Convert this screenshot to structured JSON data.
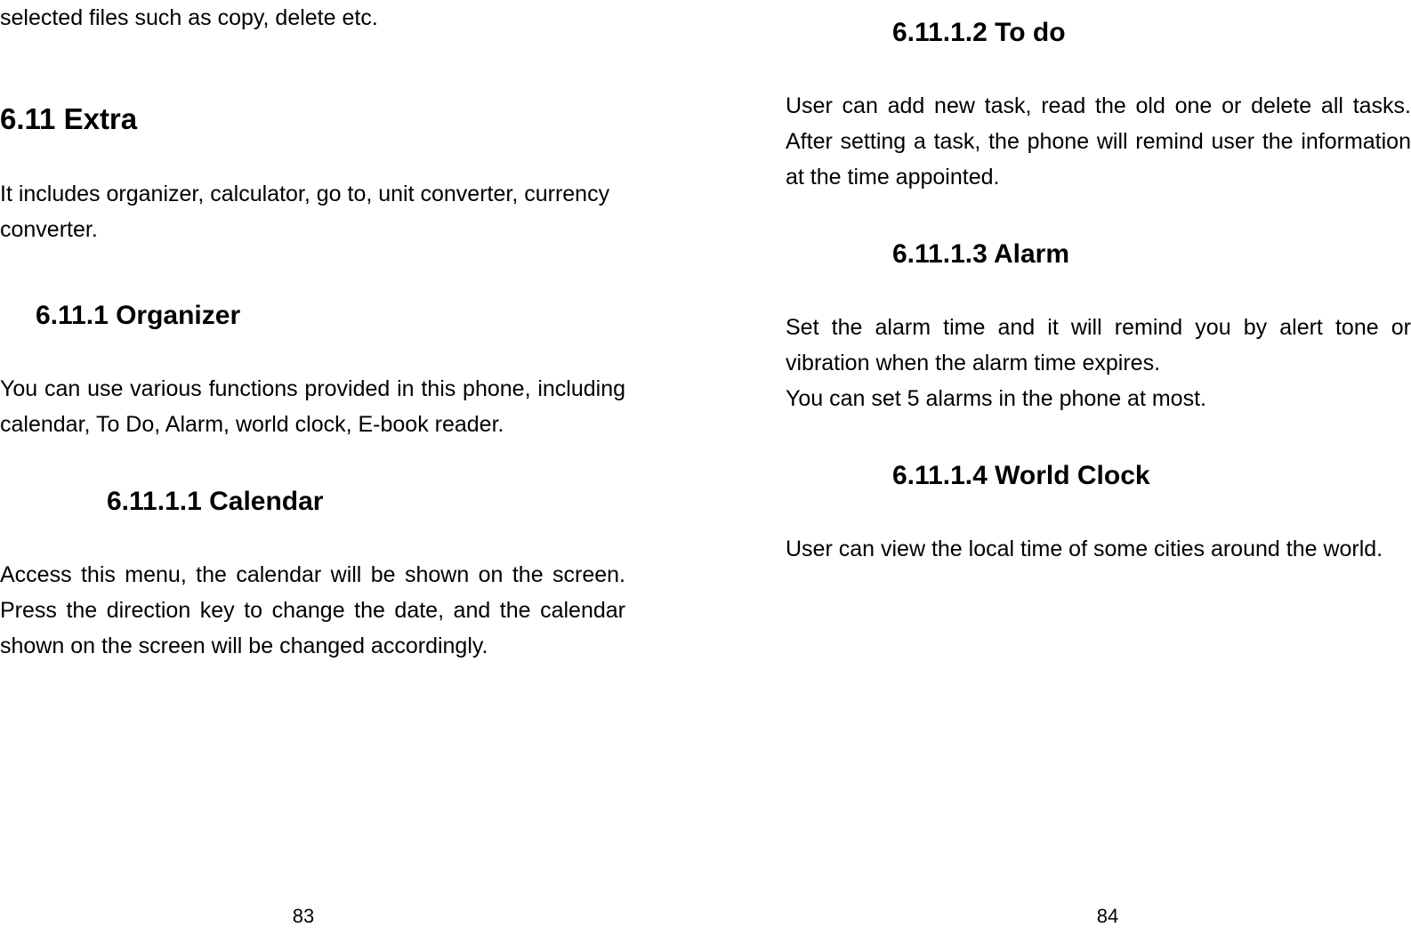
{
  "left_page": {
    "opening_line": "selected files such as copy, delete etc.",
    "section_extra": {
      "heading": "6.11  Extra",
      "body": "It includes organizer, calculator, go to, unit converter, currency converter."
    },
    "section_organizer": {
      "heading": "6.11.1  Organizer",
      "body": "You can use various functions provided in this phone, including calendar, To Do, Alarm, world clock, E-book reader."
    },
    "section_calendar": {
      "heading": "6.11.1.1  Calendar",
      "body": "Access this menu, the calendar will be shown on the screen. Press the direction key to change the date, and the calendar shown on the screen will be changed accordingly."
    },
    "page_number": "83"
  },
  "right_page": {
    "section_todo": {
      "heading": "6.11.1.2  To do",
      "body": "User can add new task, read the old one or delete all tasks. After setting a task, the phone will remind user the information at the time appointed."
    },
    "section_alarm": {
      "heading": "6.11.1.3  Alarm",
      "body1": "Set the alarm time and it will remind you by alert tone or vibration when the alarm time expires.",
      "body2": "You can set 5 alarms in the phone at most."
    },
    "section_worldclock": {
      "heading": "6.11.1.4  World Clock",
      "body": "User can view the local time of some cities around the world."
    },
    "page_number": "84"
  }
}
